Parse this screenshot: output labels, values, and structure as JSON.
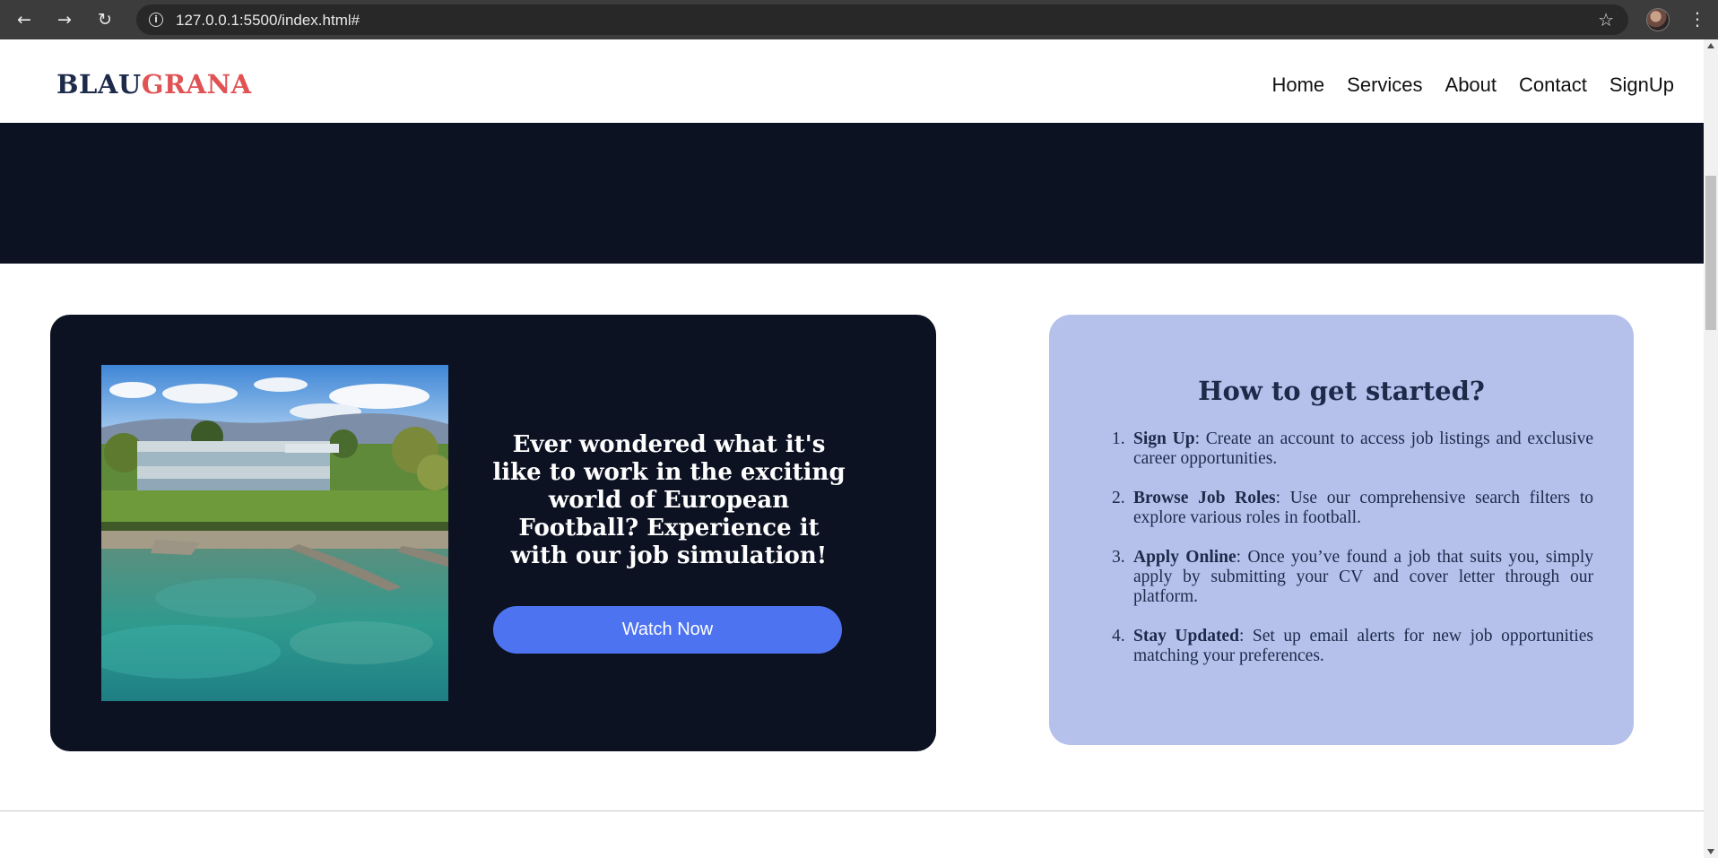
{
  "browser": {
    "url": "127.0.0.1:5500/index.html#",
    "back_icon": "arrow-left-icon",
    "forward_icon": "arrow-right-icon",
    "reload_icon": "reload-icon",
    "info_icon": "info-icon",
    "star_icon": "star-icon",
    "menu_icon": "kebab-menu-icon"
  },
  "header": {
    "logo_part1": "BLAU",
    "logo_part2": "GRANA",
    "nav": [
      "Home",
      "Services",
      "About",
      "Contact",
      "SignUp"
    ]
  },
  "video_card": {
    "heading": "Ever wondered what it's like to work in the exciting world of European Football? Experience it with our job simulation!",
    "button": "Watch Now"
  },
  "steps": {
    "title": "How to get started?",
    "items": [
      {
        "num": "1.",
        "label": "Sign Up",
        "text": ": Create an account to access job listings and exclusive career opportunities."
      },
      {
        "num": "2.",
        "label": "Browse Job Roles",
        "text": ": Use our comprehensive search filters to explore various roles in football."
      },
      {
        "num": "3.",
        "label": "Apply Online",
        "text": ": Once you’ve found a job that suits you, simply apply by submitting your CV and cover letter through our platform."
      },
      {
        "num": "4.",
        "label": "Stay Updated",
        "text": ": Set up email alerts for new job opportunities matching your preferences."
      }
    ]
  },
  "colors": {
    "navy": "#0d1223",
    "accent_red": "#e05254",
    "button_blue": "#4d73f0",
    "card_lavender": "#b5c1eb"
  }
}
